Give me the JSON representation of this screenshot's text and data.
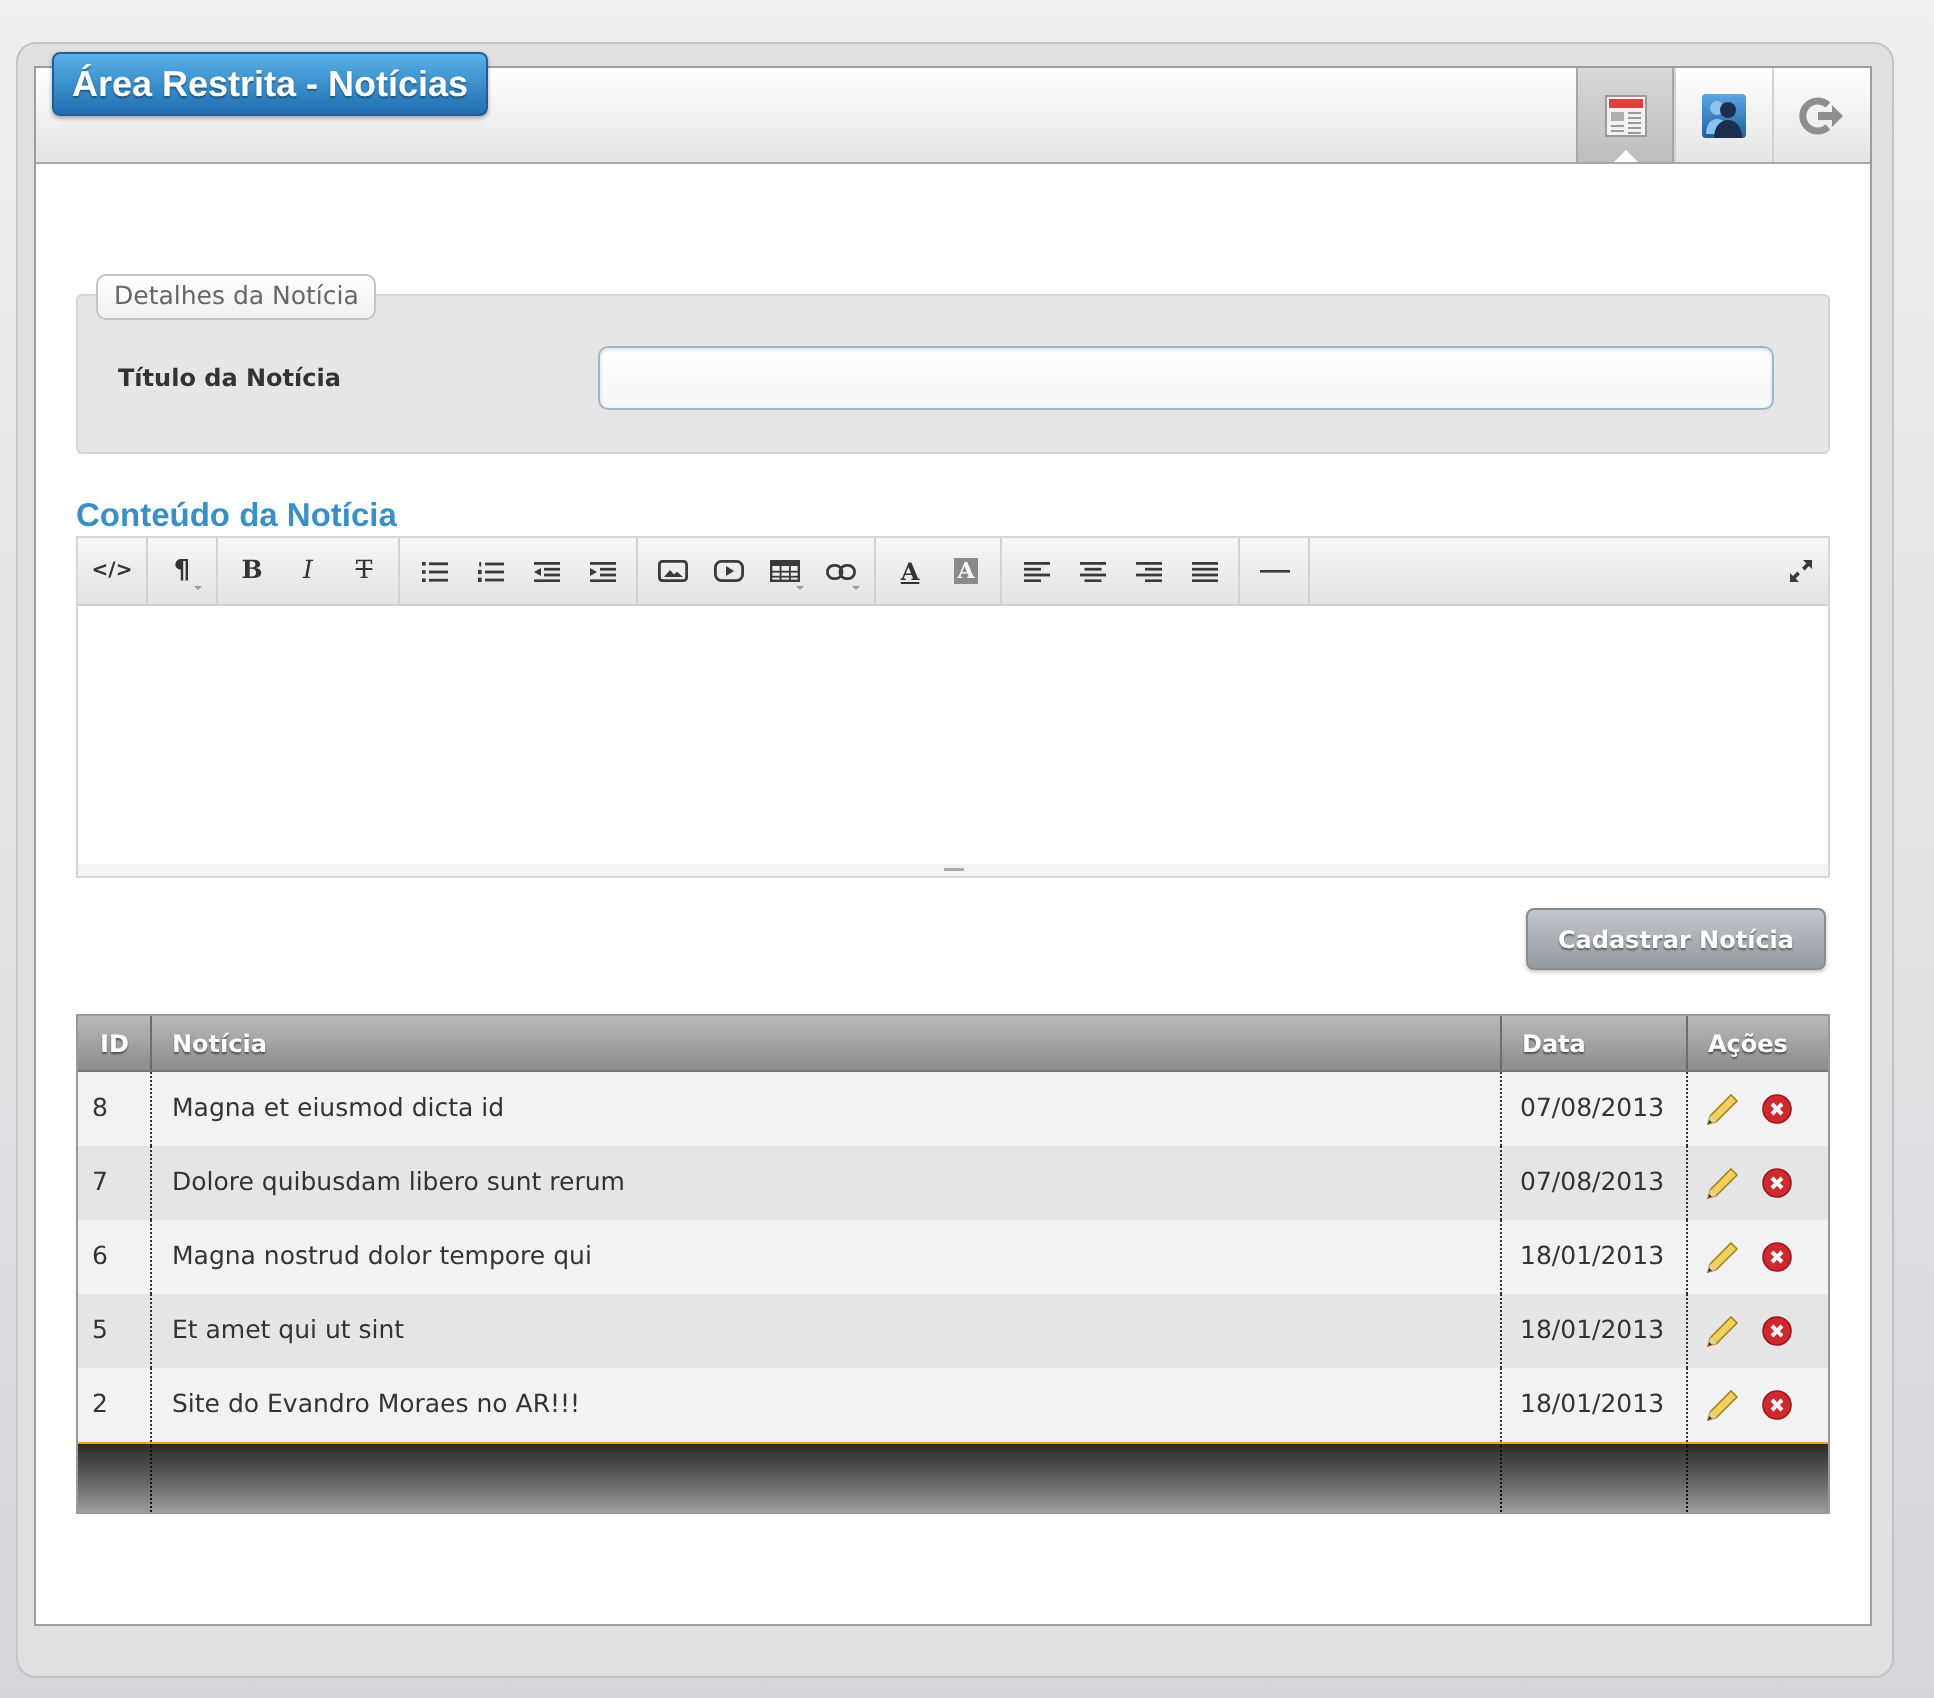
{
  "header": {
    "title": "Área Restrita - Notícias",
    "tabs": [
      {
        "kind": "news",
        "selected": true
      },
      {
        "kind": "profile",
        "selected": false
      },
      {
        "kind": "logout",
        "selected": false
      }
    ]
  },
  "details": {
    "legend": "Detalhes da Notícia",
    "fields": [
      {
        "label": "Título da Notícia"
      }
    ]
  },
  "editor": {
    "heading": "Conteúdo da Notícia",
    "toolbar": [
      {
        "buttons": [
          {
            "kind": "html",
            "label": "</>"
          }
        ]
      },
      {
        "buttons": [
          {
            "kind": "format",
            "label": "¶"
          }
        ]
      },
      {
        "buttons": [
          {
            "kind": "bold",
            "label": "B"
          },
          {
            "kind": "italic",
            "label": "I"
          },
          {
            "kind": "strike",
            "label": "T"
          }
        ]
      },
      {
        "buttons": [
          {
            "kind": "unordered-list"
          },
          {
            "kind": "ordered-list"
          },
          {
            "kind": "outdent"
          },
          {
            "kind": "indent"
          }
        ]
      },
      {
        "buttons": [
          {
            "kind": "image"
          },
          {
            "kind": "video"
          },
          {
            "kind": "table"
          },
          {
            "kind": "link"
          }
        ]
      },
      {
        "buttons": [
          {
            "kind": "font-color",
            "label": "A"
          },
          {
            "kind": "back-color",
            "label": "A"
          }
        ]
      },
      {
        "buttons": [
          {
            "kind": "align-left"
          },
          {
            "kind": "align-center"
          },
          {
            "kind": "align-right"
          },
          {
            "kind": "justify"
          }
        ]
      },
      {
        "buttons": [
          {
            "kind": "horizontal-rule"
          }
        ]
      }
    ],
    "toolbar_right": [
      {
        "kind": "fullscreen"
      }
    ]
  },
  "submit_button": {
    "label": "Cadastrar Notícia"
  },
  "table": {
    "columns": [
      "ID",
      "Notícia",
      "Data",
      "Ações"
    ],
    "rows": [
      {
        "id": "8",
        "title": "Magna et eiusmod dicta id",
        "date": "07/08/2013"
      },
      {
        "id": "7",
        "title": "Dolore quibusdam libero sunt rerum",
        "date": "07/08/2013"
      },
      {
        "id": "6",
        "title": "Magna nostrud dolor tempore qui",
        "date": "18/01/2013"
      },
      {
        "id": "5",
        "title": "Et amet qui ut sint",
        "date": "18/01/2013"
      },
      {
        "id": "2",
        "title": "Site do Evandro Moraes no AR!!!",
        "date": "18/01/2013"
      }
    ]
  }
}
